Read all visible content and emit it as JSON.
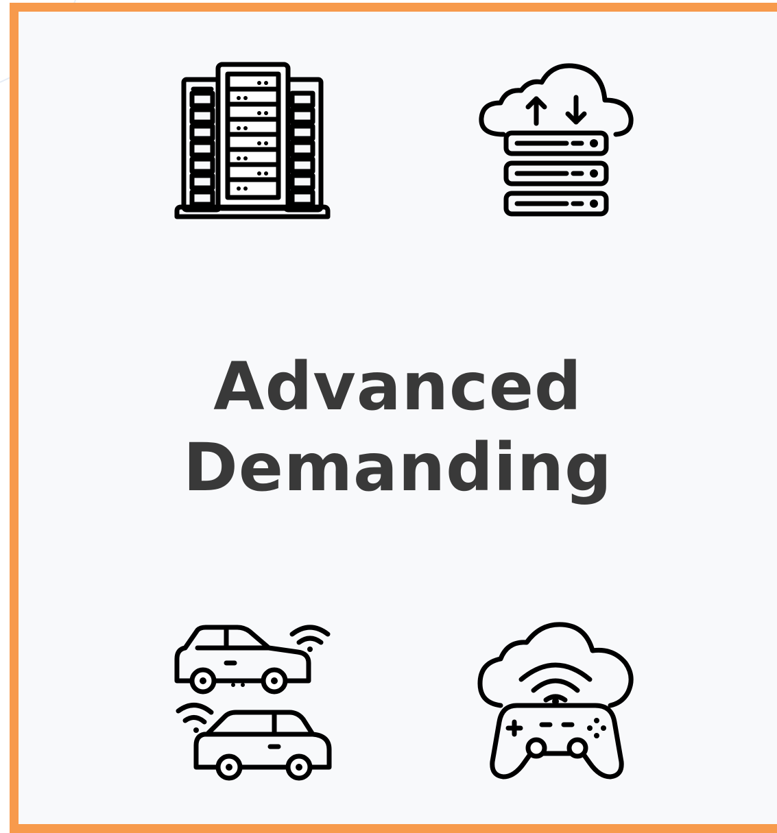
{
  "title": {
    "line1": "Advanced",
    "line2": "Demanding"
  },
  "icons": [
    {
      "name": "server-rack-icon"
    },
    {
      "name": "cloud-server-icon"
    },
    {
      "name": "connected-cars-icon"
    },
    {
      "name": "cloud-gaming-icon"
    }
  ],
  "colors": {
    "frame": "#F79A4C",
    "text": "#393939",
    "icon_stroke": "#000000",
    "network_dots": "#8fb3f0"
  }
}
